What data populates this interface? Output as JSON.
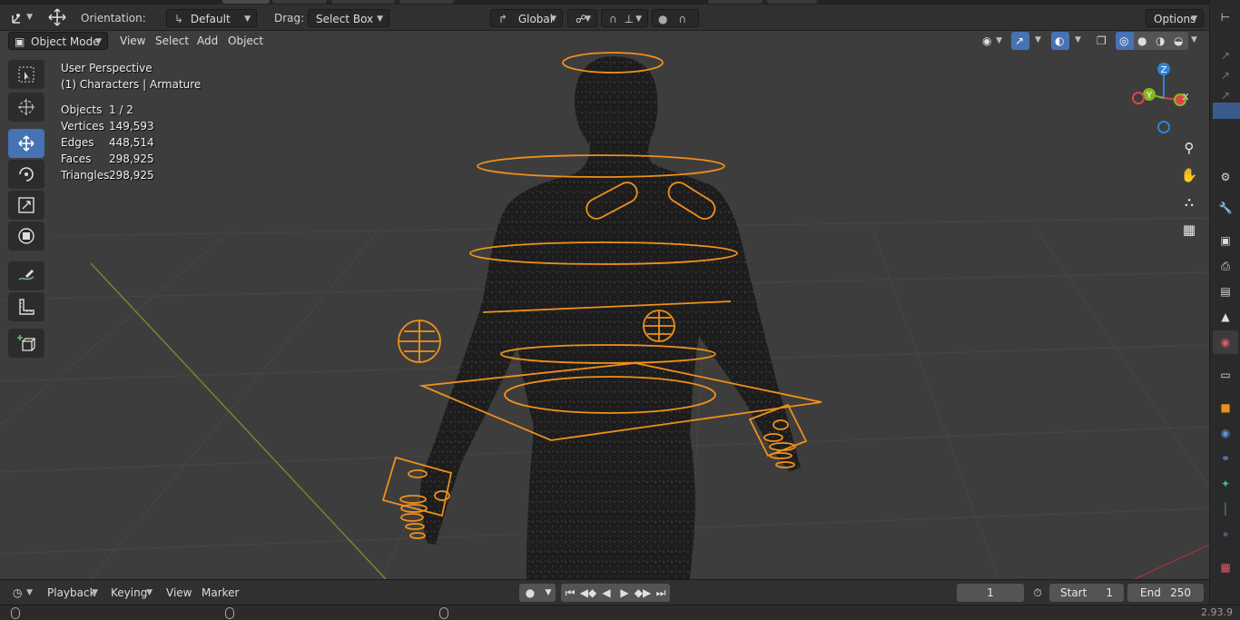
{
  "header": {
    "orientation_label": "Orientation:",
    "orientation_value": "Default",
    "drag_label": "Drag:",
    "drag_value": "Select Box",
    "transform_space": "Global",
    "options_label": "Options"
  },
  "viewport_header": {
    "mode": "Object Mode",
    "menu": [
      "View",
      "Select",
      "Add",
      "Object"
    ]
  },
  "viewport": {
    "perspective_label": "User Perspective",
    "collection_label": "(1) Characters | Armature",
    "stats": [
      {
        "key": "Objects",
        "value": "1 / 2"
      },
      {
        "key": "Vertices",
        "value": "149,593"
      },
      {
        "key": "Edges",
        "value": "448,514"
      },
      {
        "key": "Faces",
        "value": "298,925"
      },
      {
        "key": "Triangles",
        "value": "298,925"
      }
    ],
    "gizmo_axes": [
      "Z",
      "Y",
      "X"
    ]
  },
  "tools": [
    "select-box-icon",
    "cursor-icon",
    "move-icon",
    "rotate-icon",
    "scale-icon",
    "transform-icon",
    "annotate-icon",
    "measure-icon",
    "add-cube-icon"
  ],
  "timeline": {
    "menu": [
      "Playback",
      "Keying",
      "View",
      "Marker"
    ],
    "current_frame": "1",
    "start_label": "Start",
    "start_value": "1",
    "end_label": "End",
    "end_value": "250"
  },
  "status": {
    "version": "2.93.9"
  },
  "colors": {
    "accent": "#4772b3",
    "selection_orange": "#f0901a",
    "axis_x": "#e0414f",
    "axis_y": "#84b81e",
    "axis_z": "#2f83d6"
  }
}
